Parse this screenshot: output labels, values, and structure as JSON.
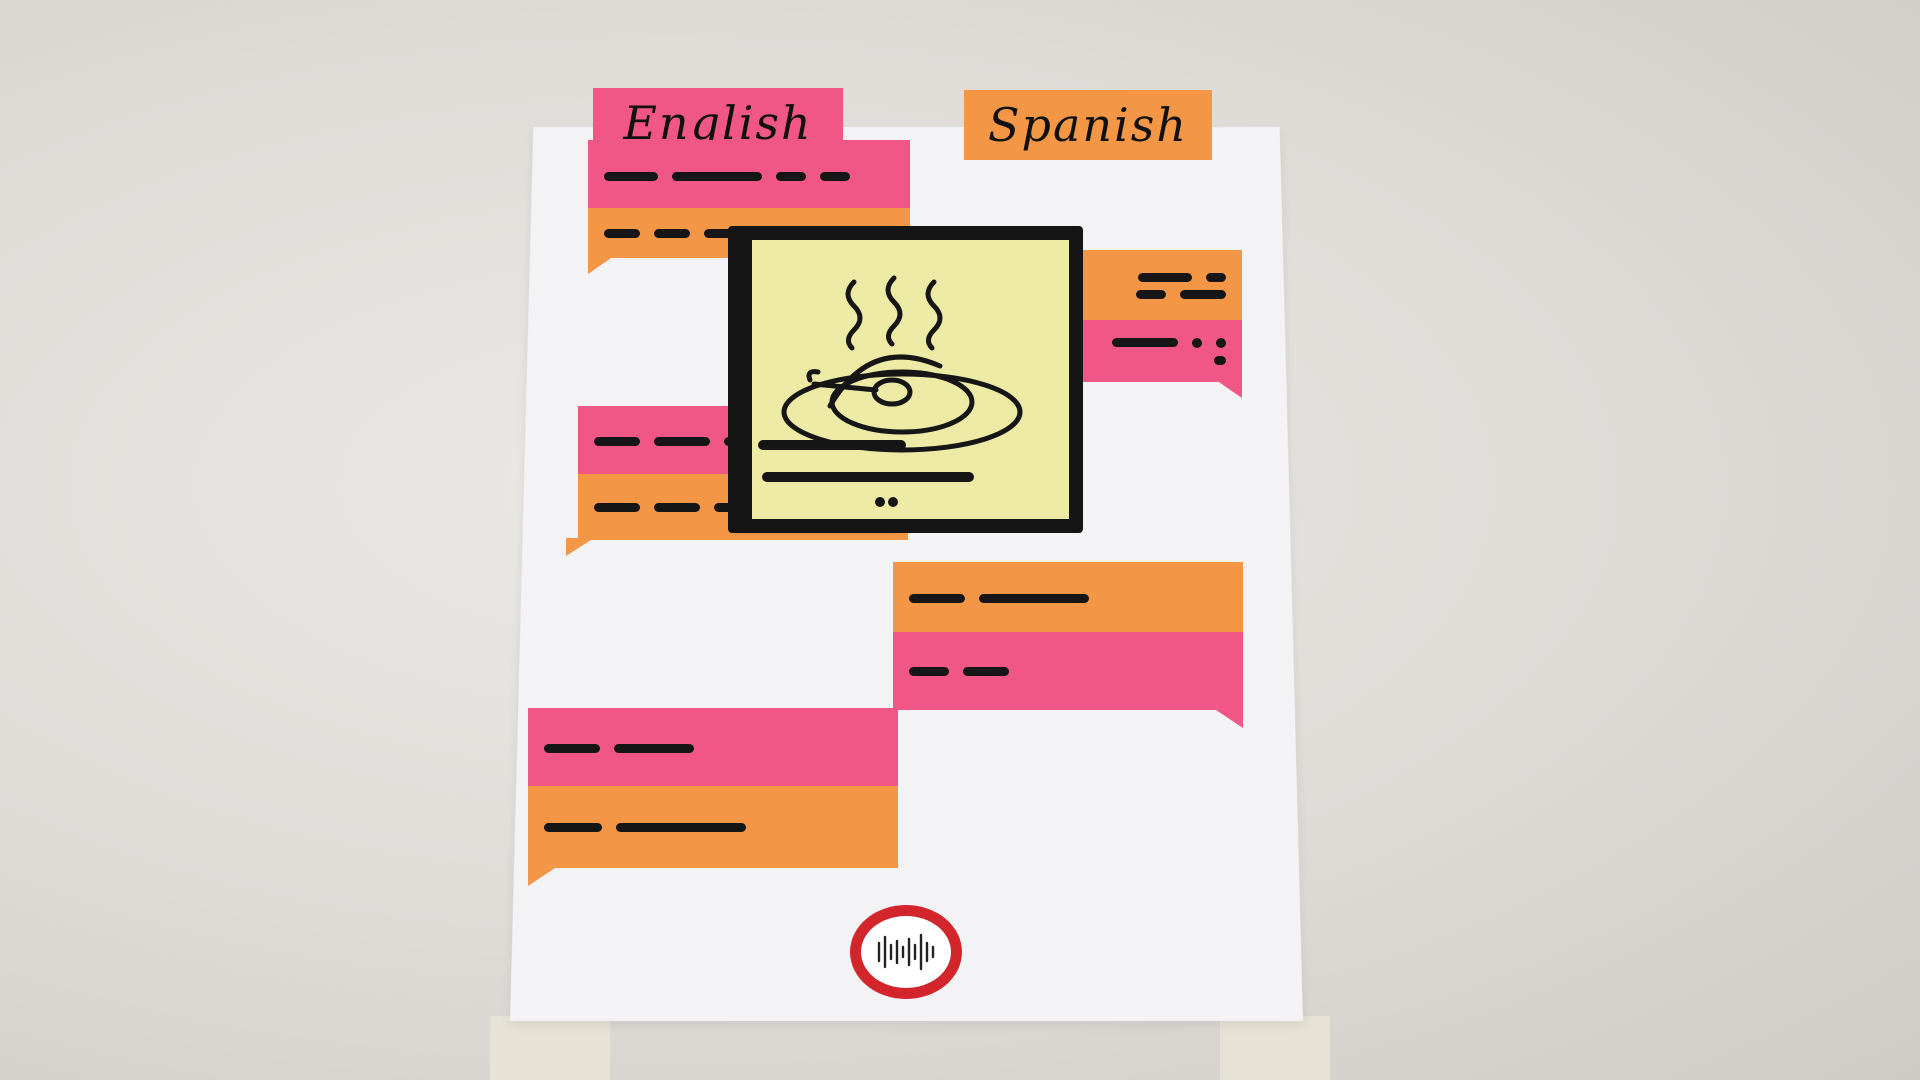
{
  "header": {
    "source_language": "English",
    "target_language": "Spanish"
  },
  "colors": {
    "pink": "#f05686",
    "orange": "#f39646",
    "card_yellow": "#edeaa6",
    "record_ring": "#d3262c"
  },
  "conversation": {
    "messages": [
      {
        "speaker": "left",
        "top_color": "pink",
        "bottom_color": "orange"
      },
      {
        "speaker": "right",
        "top_color": "orange",
        "bottom_color": "pink"
      },
      {
        "speaker": "left",
        "top_color": "pink",
        "bottom_color": "orange"
      },
      {
        "speaker": "right",
        "top_color": "orange",
        "bottom_color": "pink"
      },
      {
        "speaker": "left",
        "top_color": "pink",
        "bottom_color": "orange"
      }
    ]
  },
  "image_card": {
    "icon": "hot-food-plate-icon"
  },
  "record_button": {
    "icon": "audio-waveform-icon"
  }
}
